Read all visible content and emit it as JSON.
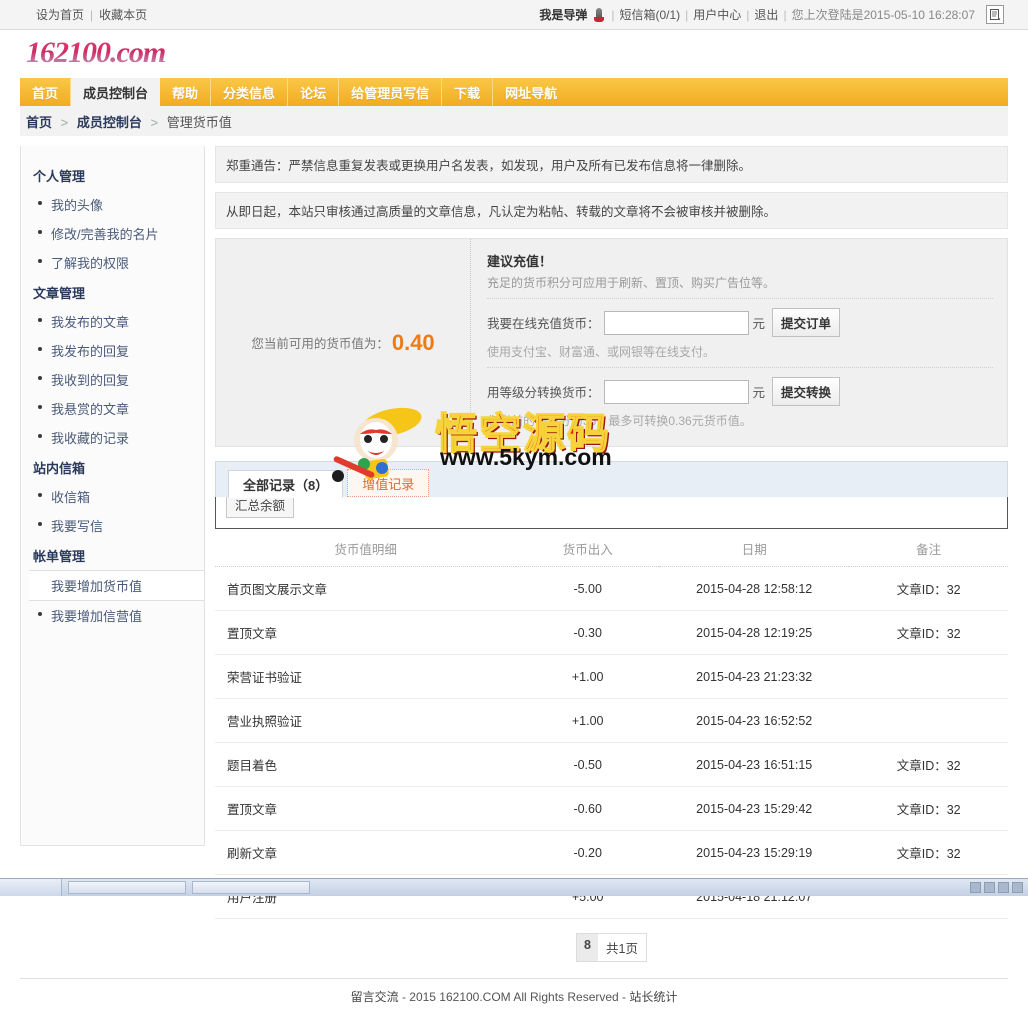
{
  "topbar": {
    "set_home": "设为首页",
    "bookmark": "收藏本页",
    "username": "我是导弹",
    "mailbox": "短信箱(0/1)",
    "user_center": "用户中心",
    "logout": "退出",
    "last_login": "您上次登陆是2015-05-10 16:28:07",
    "sep": "|"
  },
  "brand": {
    "logo": "162100.com"
  },
  "nav": {
    "items": [
      {
        "label": "首页",
        "active": false
      },
      {
        "label": "成员控制台",
        "active": true
      },
      {
        "label": "帮助",
        "active": false
      },
      {
        "label": "分类信息",
        "active": false
      },
      {
        "label": "论坛",
        "active": false
      },
      {
        "label": "给管理员写信",
        "active": false
      },
      {
        "label": "下载",
        "active": false
      },
      {
        "label": "网址导航",
        "active": false
      }
    ]
  },
  "breadcrumb": {
    "home": "首页",
    "section": "成员控制台",
    "current": "管理货币值",
    "sep": ">"
  },
  "sidebar": {
    "groups": [
      {
        "title": "个人管理",
        "items": [
          {
            "label": "我的头像",
            "active": false
          },
          {
            "label": "修改/完善我的名片",
            "active": false
          },
          {
            "label": "了解我的权限",
            "active": false
          }
        ]
      },
      {
        "title": "文章管理",
        "items": [
          {
            "label": "我发布的文章",
            "active": false
          },
          {
            "label": "我发布的回复",
            "active": false
          },
          {
            "label": "我收到的回复",
            "active": false
          },
          {
            "label": "我悬赏的文章",
            "active": false
          },
          {
            "label": "我收藏的记录",
            "active": false
          }
        ]
      },
      {
        "title": "站内信箱",
        "items": [
          {
            "label": "收信箱",
            "active": false
          },
          {
            "label": "我要写信",
            "active": false
          }
        ]
      },
      {
        "title": "帐单管理",
        "items": [
          {
            "label": "我要增加货币值",
            "active": true
          },
          {
            "label": "我要增加信营值",
            "active": false
          }
        ]
      }
    ]
  },
  "notices": [
    "郑重通告：严禁信息重复发表或更换用户名发表，如发现，用户及所有已发布信息将一律删除。",
    "从即日起，本站只审核通过高质量的文章信息，凡认定为粘帖、转载的文章将不会被审核并被删除。"
  ],
  "balance": {
    "label": "您当前可用的货币值为：",
    "value": "0.40",
    "color": "#ef7b17"
  },
  "recharge": {
    "title": "建议充值！",
    "subtitle": "充足的货币积分可应用于刷新、置顶、购买广告位等。",
    "online": {
      "label": "我要在线充值货币：",
      "value": "",
      "unit": "元",
      "button": "提交订单",
      "hint": "使用支付宝、财富通、或网银等在线支付。"
    },
    "convert": {
      "label": "用等级分转换货币：",
      "value": "",
      "unit": "元",
      "button": "提交转换",
      "hint": "您当前的等级分为36，最多可转换0.36元货币值。"
    }
  },
  "tabs": {
    "items": [
      {
        "label": "全部记录（8）",
        "active": true
      },
      {
        "label": "增值记录",
        "active": false
      }
    ],
    "summary_button": "汇总余额"
  },
  "ledger": {
    "columns": [
      "货币值明细",
      "货币出入",
      "日期",
      "备注"
    ],
    "rows": [
      {
        "detail": "首页图文展示文章",
        "amount": "-5.00",
        "date": "2015-04-28 12:58:12",
        "note": "文章ID：32"
      },
      {
        "detail": "置顶文章",
        "amount": "-0.30",
        "date": "2015-04-28 12:19:25",
        "note": "文章ID：32"
      },
      {
        "detail": "荣营证书验证",
        "amount": "+1.00",
        "date": "2015-04-23 21:23:32",
        "note": ""
      },
      {
        "detail": "营业执照验证",
        "amount": "+1.00",
        "date": "2015-04-23 16:52:52",
        "note": ""
      },
      {
        "detail": "题目着色",
        "amount": "-0.50",
        "date": "2015-04-23 16:51:15",
        "note": "文章ID：32"
      },
      {
        "detail": "置顶文章",
        "amount": "-0.60",
        "date": "2015-04-23 15:29:42",
        "note": "文章ID：32"
      },
      {
        "detail": "刷新文章",
        "amount": "-0.20",
        "date": "2015-04-23 15:29:19",
        "note": "文章ID：32"
      },
      {
        "detail": "用户注册",
        "amount": "+5.00",
        "date": "2015-04-18 21:12:07",
        "note": ""
      }
    ]
  },
  "pager": {
    "count": "8",
    "total": "共1页"
  },
  "footer": {
    "link1": "留言交流",
    "text": "- 2015 162100.COM All Rights Reserved -",
    "link2": "站长统计"
  },
  "watermark": {
    "title": "悟空源码",
    "url": "www.5kym.com"
  }
}
